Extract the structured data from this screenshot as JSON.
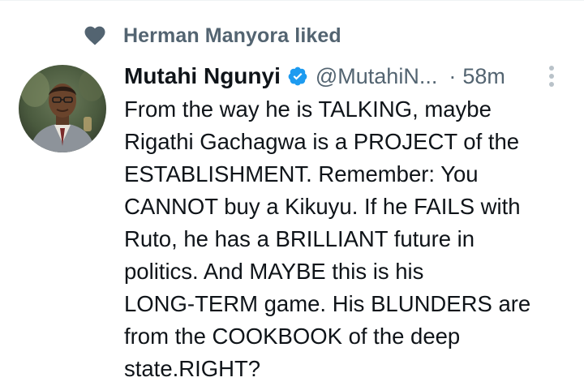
{
  "social_context": {
    "text": "Herman Manyora liked",
    "icon": "heart-icon"
  },
  "tweet": {
    "author_name": "Mutahi Ngunyi",
    "author_handle": "@MutahiN...",
    "separator": "·",
    "timestamp": "58m",
    "verified": true,
    "body_lines": [
      "From the way he is TALKING, maybe",
      "Rigathi Gachagwa is a PROJECT of the",
      "ESTABLISHMENT. Remember: You",
      "CANNOT buy a Kikuyu. If he FAILS with",
      "Ruto, he has a BRILLIANT future in",
      "politics. And MAYBE this is his",
      "LONG-TERM game. His BLUNDERS are",
      "from the COOKBOOK of the deep",
      "state.RIGHT?"
    ]
  },
  "colors": {
    "primary_text": "#0f1419",
    "secondary_text": "#536471",
    "verified_blue": "#1d9bf0",
    "heart_icon": "#536471"
  }
}
